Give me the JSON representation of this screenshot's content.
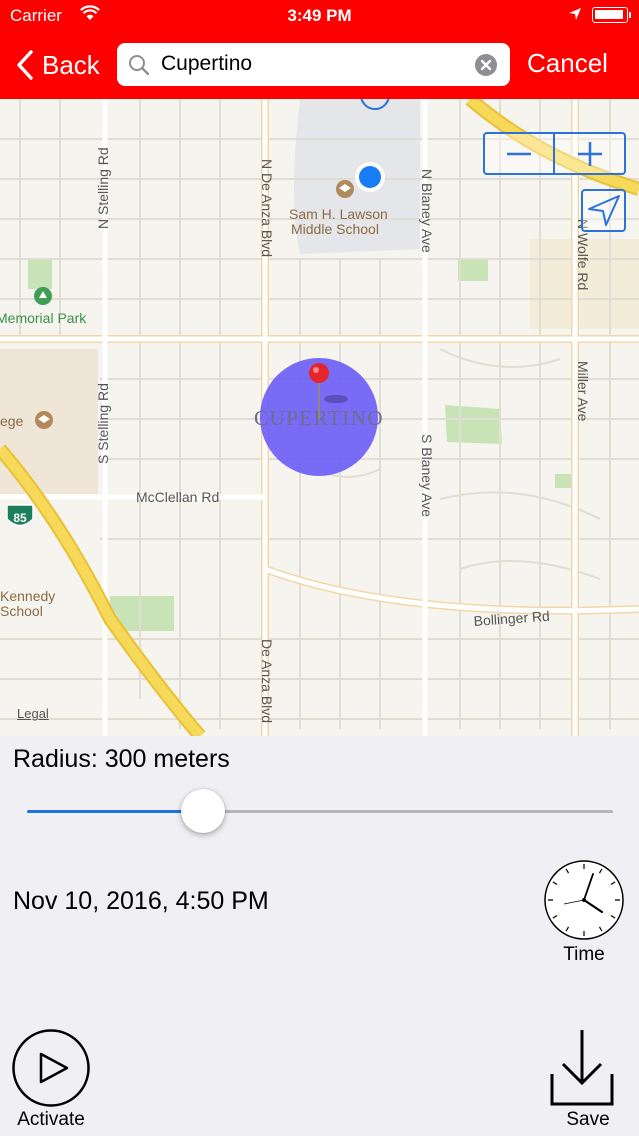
{
  "status_bar": {
    "carrier": "Carrier",
    "time": "3:49 PM"
  },
  "nav": {
    "back_label": "Back",
    "search_value": "Cupertino",
    "cancel_label": "Cancel"
  },
  "map": {
    "labels": {
      "stelling_n": "N Stelling Rd",
      "stelling_s": "S Stelling Rd",
      "de_anza_n": "N De Anza Blvd",
      "de_anza_s": "De Anza Blvd",
      "blaney_n": "N Blaney Ave",
      "blaney_s": "S Blaney Ave",
      "wolfe_n": "N Wolfe Rd",
      "miller": "Miller Ave",
      "mcclellan": "McClellan Rd",
      "bollinger": "Bollinger Rd",
      "memorial_park": "Memorial Park",
      "school_line1": "Sam H. Lawson",
      "school_line2": "Middle School",
      "city": "CUPERTINO",
      "college": "ege",
      "kennedy_line1": "Kennedy",
      "kennedy_line2": "School",
      "highway": "85"
    },
    "legal": "Legal",
    "accent_color": "#2b73d9",
    "radius_circle_color": "#6a5cf5"
  },
  "radius": {
    "label": "Radius: 300 meters",
    "slider_fraction": 0.3
  },
  "schedule": {
    "datetime": "Nov 10, 2016, 4:50 PM",
    "time_button_label": "Time"
  },
  "actions": {
    "activate_label": "Activate",
    "save_label": "Save"
  },
  "colors": {
    "header": "#ff0000",
    "slider_fill": "#1b74e4",
    "background": "#efeff4"
  }
}
